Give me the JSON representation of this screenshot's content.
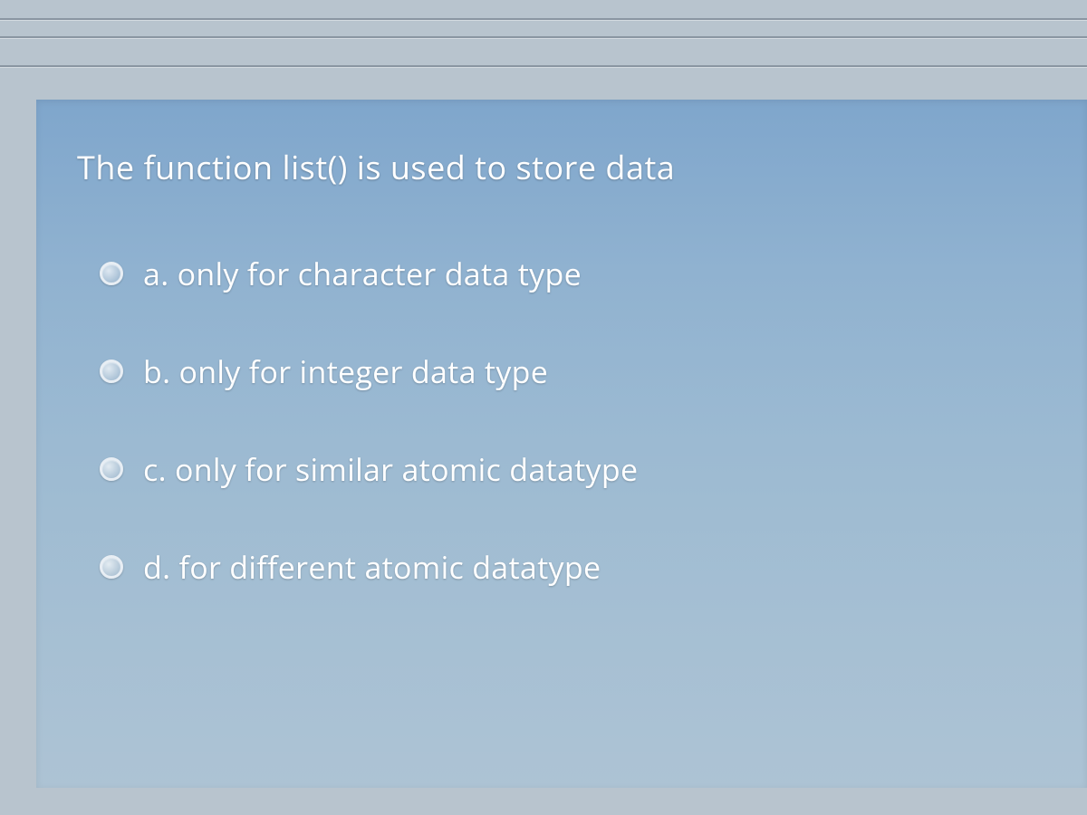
{
  "question": {
    "prompt": "The function list() is used to store data",
    "options": [
      {
        "letter": "a.",
        "text": "only for character data type"
      },
      {
        "letter": "b.",
        "text": "only for integer data type"
      },
      {
        "letter": "c.",
        "text": "only for similar atomic datatype"
      },
      {
        "letter": "d.",
        "text": "for different atomic datatype"
      }
    ]
  }
}
